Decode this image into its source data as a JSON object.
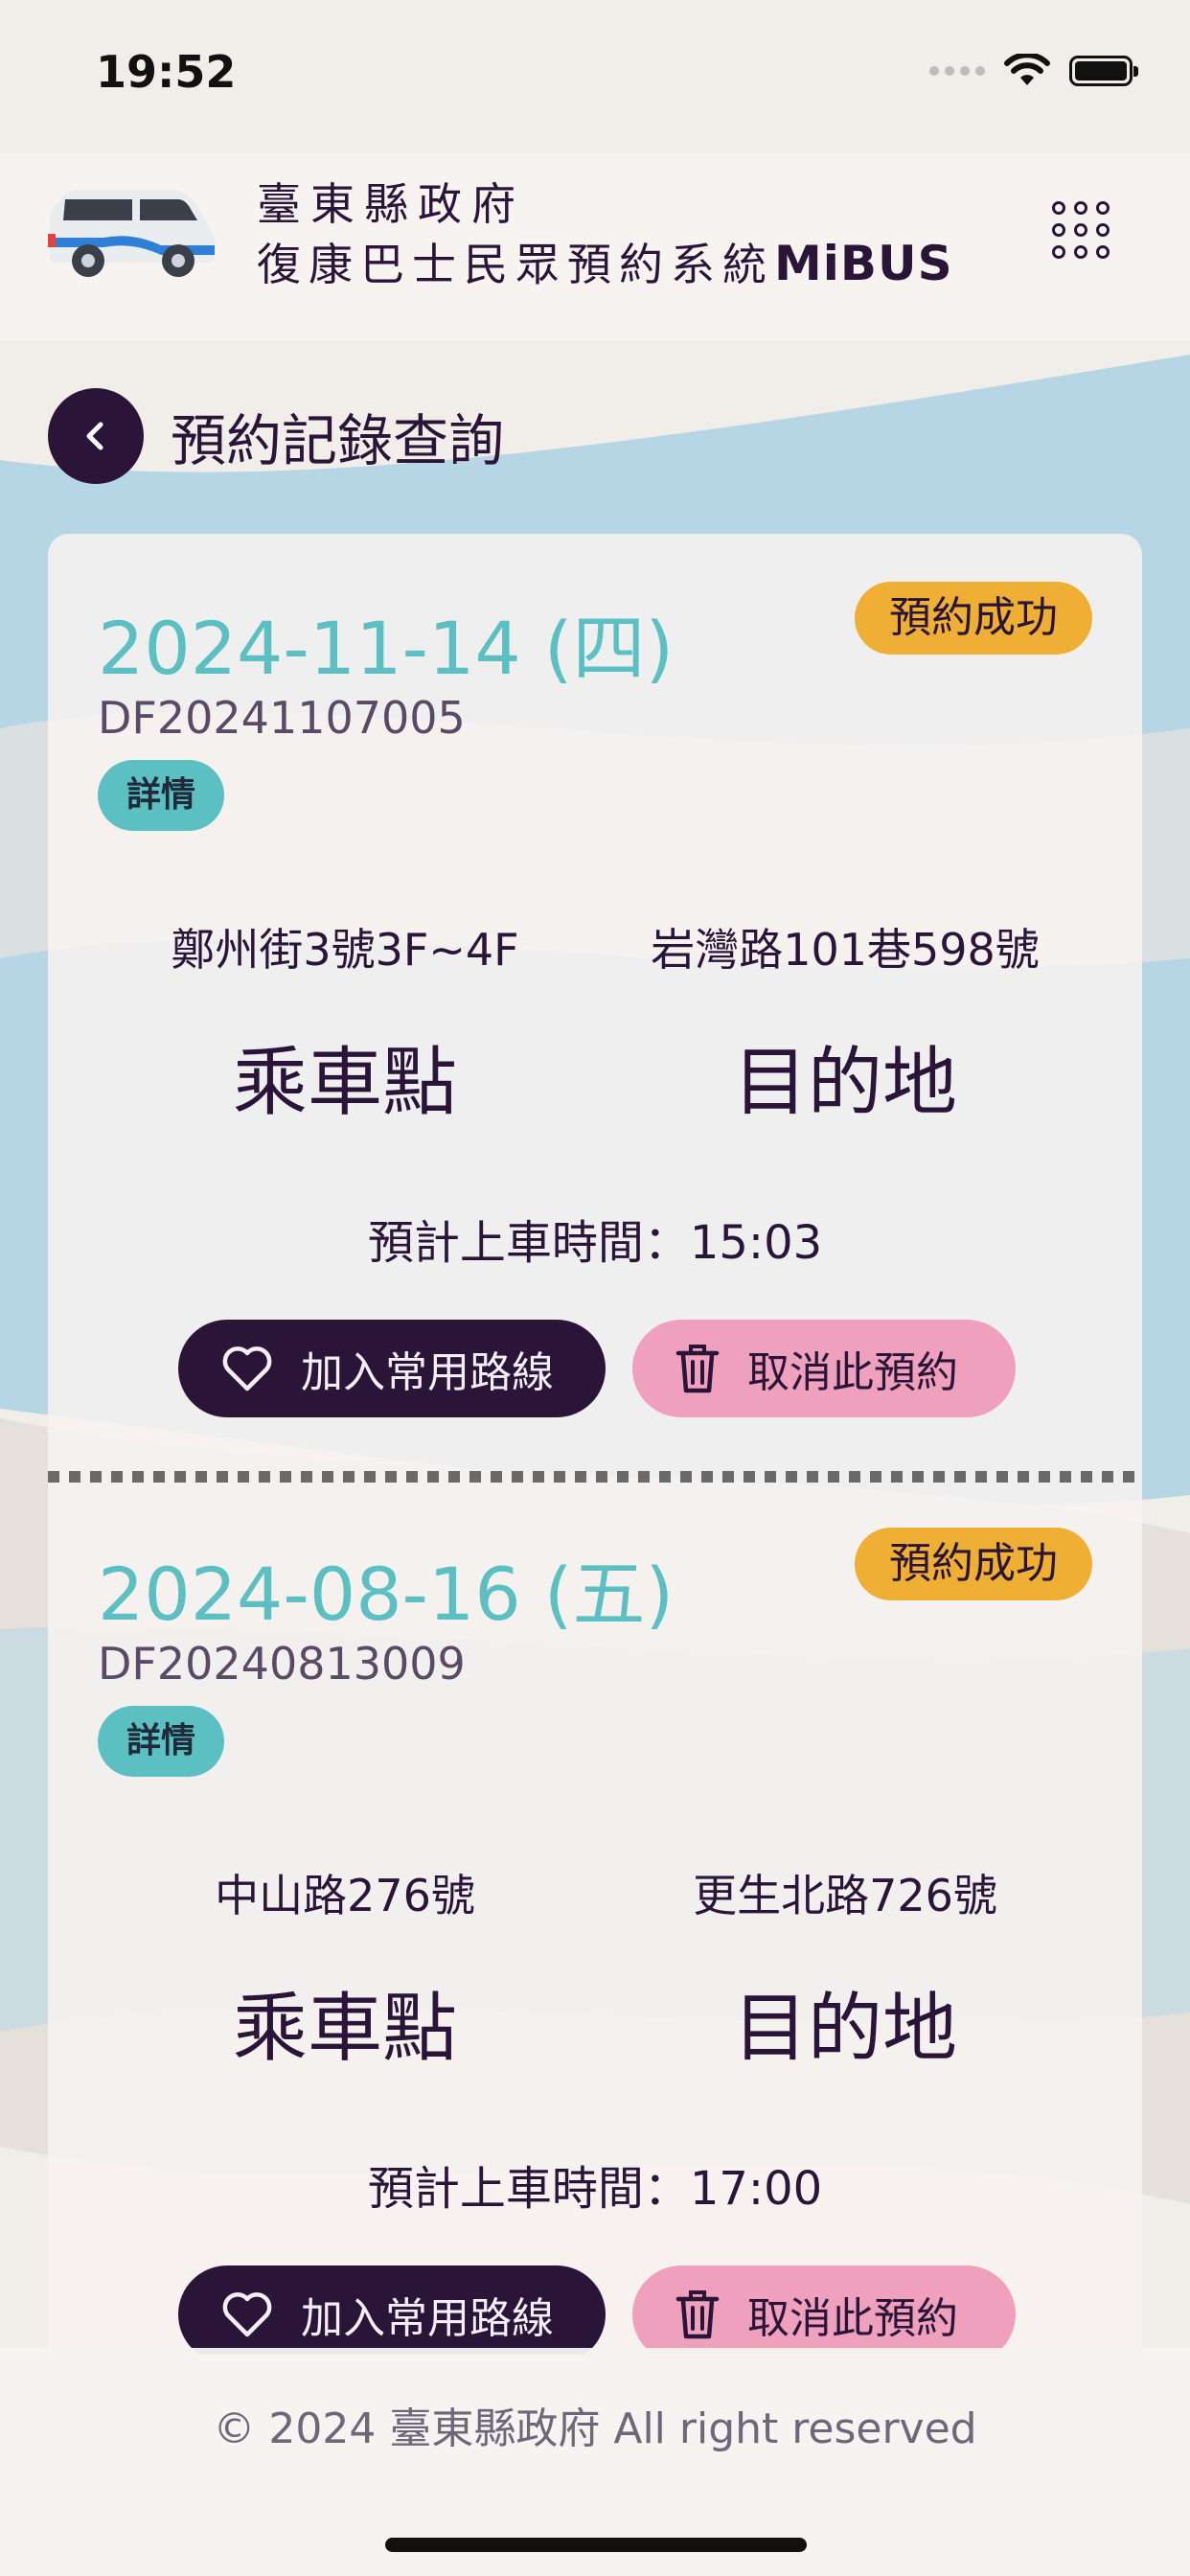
{
  "status_bar": {
    "time": "19:52"
  },
  "header": {
    "title_line1": "臺東縣政府",
    "title_line2": "復康巴士民眾預約系統",
    "brand": "MiBUS"
  },
  "page": {
    "title": "預約記錄查詢"
  },
  "records": [
    {
      "date": "2024-11-14 (四)",
      "status": "預約成功",
      "code": "DF20241107005",
      "detail_label": "詳情",
      "pickup_address": "鄭州街3號3F~4F",
      "dropoff_address": "岩灣路101巷598號",
      "pickup_label": "乘車點",
      "dropoff_label": "目的地",
      "eta_text": "預計上車時間：15:03",
      "fav_label": "加入常用路線",
      "cancel_label": "取消此預約"
    },
    {
      "date": "2024-08-16 (五)",
      "status": "預約成功",
      "code": "DF20240813009",
      "detail_label": "詳情",
      "pickup_address": "中山路276號",
      "dropoff_address": "更生北路726號",
      "pickup_label": "乘車點",
      "dropoff_label": "目的地",
      "eta_text": "預計上車時間：17:00",
      "fav_label": "加入常用路線",
      "cancel_label": "取消此預約"
    }
  ],
  "footer": {
    "copyright": "© 2024 臺東縣政府 All right reserved"
  },
  "colors": {
    "primary_dark": "#2a1538",
    "accent_teal": "#5cc0c3",
    "status_yellow": "#efaf34",
    "cancel_pink": "#efa0bd",
    "background_wave": "#b6d6e6"
  }
}
